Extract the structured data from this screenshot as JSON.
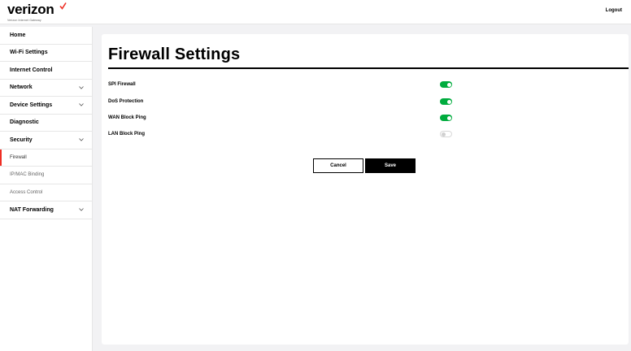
{
  "brand": {
    "name": "verizon",
    "subtitle": "Verizon Internet Gateway",
    "accent": "#ee2e24"
  },
  "header": {
    "logout_label": "Logout"
  },
  "sidebar": {
    "items": [
      {
        "label": "Home",
        "expandable": false
      },
      {
        "label": "Wi-Fi Settings",
        "expandable": false
      },
      {
        "label": "Internet Control",
        "expandable": false
      },
      {
        "label": "Network",
        "expandable": true
      },
      {
        "label": "Device Settings",
        "expandable": true
      },
      {
        "label": "Diagnostic",
        "expandable": false
      },
      {
        "label": "Security",
        "expandable": true,
        "expanded": true
      },
      {
        "label": "Firewall",
        "sub": true,
        "active": true
      },
      {
        "label": "IP/MAC Binding",
        "sub": true
      },
      {
        "label": "Access Control",
        "sub": true
      },
      {
        "label": "NAT Forwarding",
        "expandable": true
      }
    ]
  },
  "main": {
    "title": "Firewall Settings",
    "settings": [
      {
        "label": "SPI Firewall",
        "enabled": true
      },
      {
        "label": "DoS Protection",
        "enabled": true
      },
      {
        "label": "WAN Block Ping",
        "enabled": true
      },
      {
        "label": "LAN Block Ping",
        "enabled": false
      }
    ],
    "cancel_label": "Cancel",
    "save_label": "Save"
  },
  "colors": {
    "toggle_on": "#00ac3e",
    "background": "#f2f2f4"
  }
}
